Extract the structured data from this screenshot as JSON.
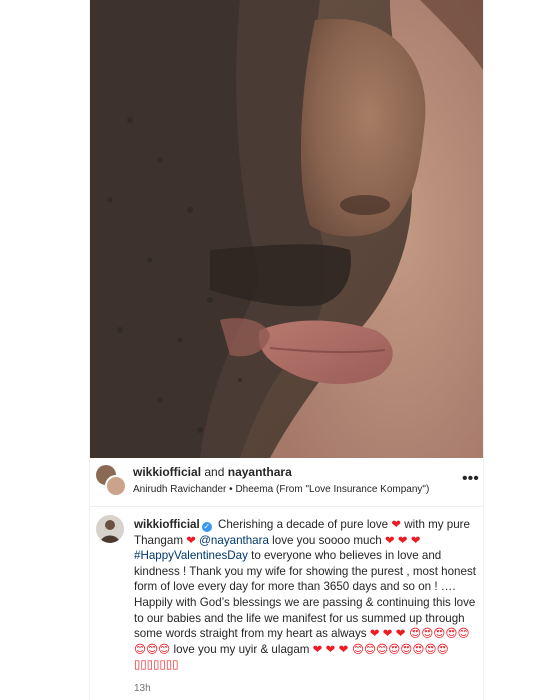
{
  "header": {
    "user1": "wikkiofficial",
    "joiner": " and ",
    "user2": "nayanthara",
    "audio": "Anirudh Ravichander • Dheema (From \"Love Insurance Kompany\")",
    "more_icon": "more-dots-icon"
  },
  "caption": {
    "username": "wikkiofficial",
    "seg1": " Cherishing a decade of pure love ",
    "heart": "❤",
    "seg2": "  with my pure Thangam ",
    "seg3": " ",
    "mention": "@nayanthara",
    "seg4": " love you soooo much ",
    "hearts3": "❤ ❤ ❤",
    "hashtag": "#HappyValentinesDay",
    "seg5": " to everyone who believes in love and kindness ! Thank you my wife for showing the purest , most honest form of love every day for more than 3650 days and so on ! …. Happily with God’s blessings we are passing & continuing this love to our babies and the life we manifest for us summed up through some words straight from my heart as always ",
    "hearts2": "❤ ❤",
    "emoji_line": "❤ 😍😍😍😍😊😊😊😊",
    "seg6": " love you my uyir & ulagam ",
    "emoji_line2": "❤ 😊😊😊😍😍😍😍😍▯▯▯▯▯▯▯"
  },
  "timestamp": "13h",
  "colors": {
    "heart": "#ed1c24",
    "link": "#00376b",
    "verified": "#3897f0"
  }
}
